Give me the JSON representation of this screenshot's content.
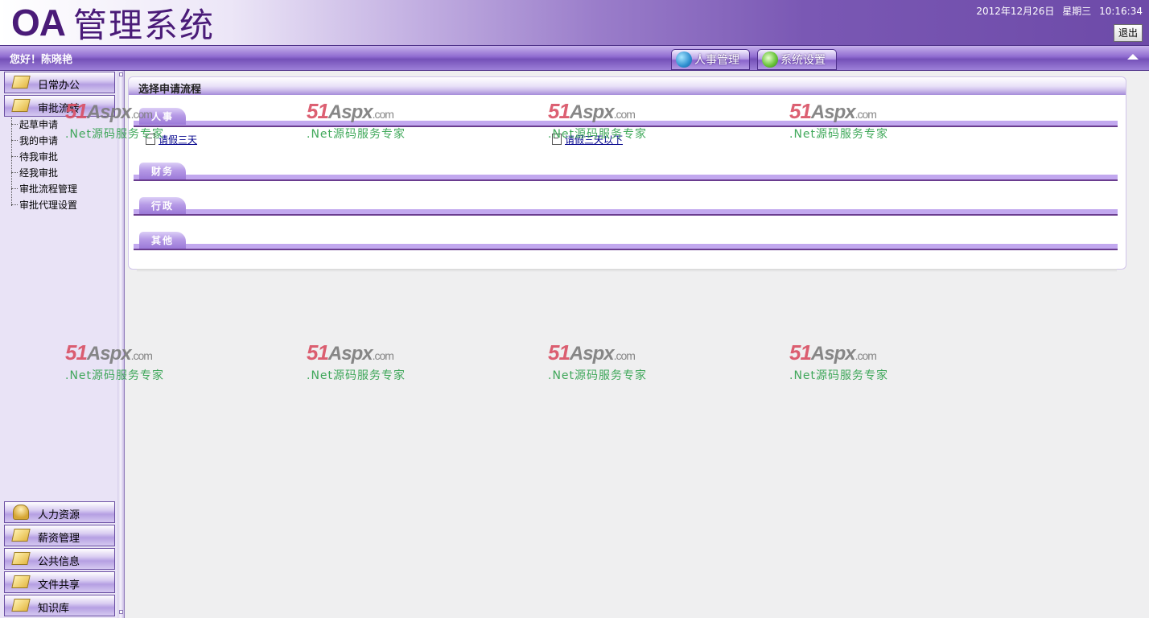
{
  "header": {
    "logo_oa": "OA",
    "logo_text": "管理系统",
    "date": "2012年12月26日",
    "weekday": "星期三",
    "time": "10:16:34",
    "logout_label": "退出"
  },
  "navbar": {
    "greeting": "您好！陈晓艳",
    "tabs": [
      {
        "label": "人事管理",
        "icon": "globe-icon"
      },
      {
        "label": "系统设置",
        "icon": "gear-icon"
      }
    ]
  },
  "sidebar": {
    "top_menus": [
      {
        "label": "日常办公",
        "icon": "book-icon"
      },
      {
        "label": "审批流转",
        "icon": "book-icon"
      }
    ],
    "sub_items": [
      "起草申请",
      "我的申请",
      "待我审批",
      "经我审批",
      "审批流程管理",
      "审批代理设置"
    ],
    "bottom_menus": [
      {
        "label": "人力资源",
        "icon": "people-icon"
      },
      {
        "label": "薪资管理",
        "icon": "book-icon"
      },
      {
        "label": "公共信息",
        "icon": "book-icon"
      },
      {
        "label": "文件共享",
        "icon": "book-icon"
      },
      {
        "label": "知识库",
        "icon": "book-icon"
      }
    ]
  },
  "main": {
    "panel_title": "选择申请流程",
    "categories": [
      {
        "label": "人事",
        "items": [
          "请假三天",
          "请假三天以下"
        ]
      },
      {
        "label": "财务",
        "items": []
      },
      {
        "label": "行政",
        "items": []
      },
      {
        "label": "其他",
        "items": []
      }
    ]
  },
  "watermark": {
    "logo_a": "51",
    "logo_b": "Aspx",
    "logo_c": ".com",
    "tagline": ".Net源码服务专家"
  },
  "colors": {
    "brand_purple": "#6d4aa8",
    "logo_text": "#4a1b78",
    "watermark_red": "#d94f63",
    "watermark_green": "#2da04a"
  }
}
